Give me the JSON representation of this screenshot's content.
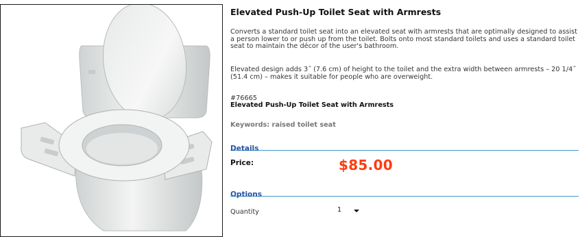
{
  "product": {
    "title": "Elevated Push-Up Toilet Seat with Armrests",
    "description_1": "Converts a standard toilet seat into an elevated seat with armrests that are optimally designed to assist a person lower to or push up from the toilet. Bolts onto most standard toilets and uses a standard toilet seat to maintain the décor of the user's bathroom.",
    "description_2": "Elevated design adds 3˝ (7.6 cm) of height to the toilet and the extra width between armrests – 20 1/4˝ (51.4 cm) – makes it suitable for people who are overweight.",
    "sku": "#76665",
    "sku_name": "Elevated Push-Up Toilet Seat with Armrests",
    "keywords": "Keywords: raised toilet seat",
    "image_icon": "toilet-seat-product-photo"
  },
  "details": {
    "heading": "Details",
    "price_label": "Price:",
    "price_value": "$85.00"
  },
  "options": {
    "heading": "Options",
    "quantity_label": "Quantity",
    "quantity_value": "1"
  },
  "colors": {
    "price": "#ff3b0f",
    "section_heading": "#2453a6",
    "section_rule": "#3e9bc7"
  }
}
